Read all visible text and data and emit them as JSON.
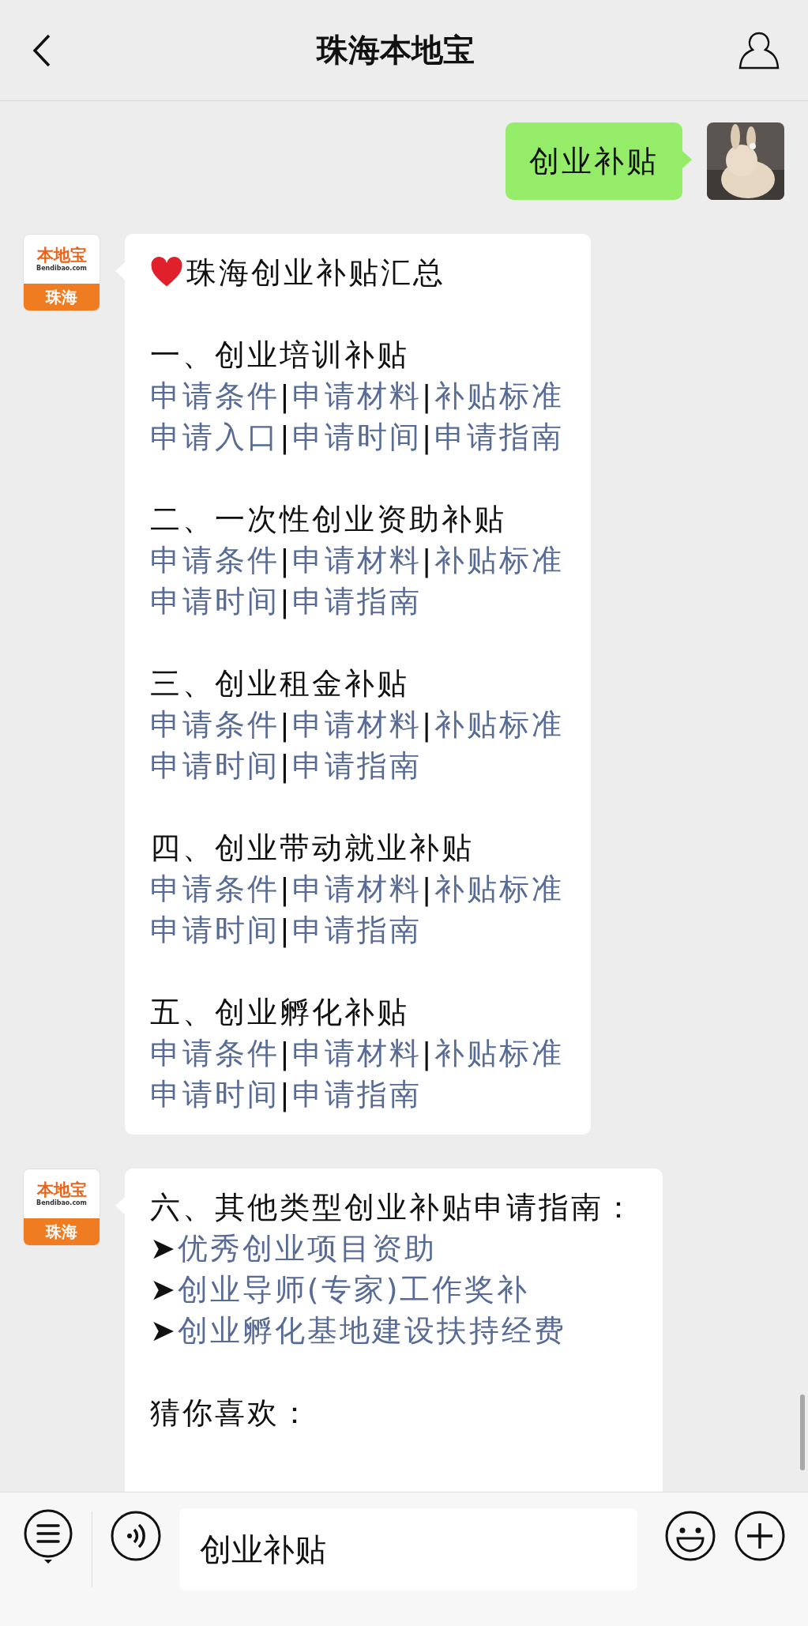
{
  "header": {
    "title": "珠海本地宝"
  },
  "messages": [
    {
      "kind": "user",
      "text": "创业补贴"
    },
    {
      "kind": "guide",
      "sender": {
        "logo": "本地宝",
        "domain": "Bendibao.com",
        "city": "珠海"
      },
      "title": "珠海创业补贴汇总",
      "separator": "|",
      "sections": [
        {
          "heading": "一、创业培训补贴",
          "rows": [
            [
              "申请条件",
              "申请材料",
              "补贴标准"
            ],
            [
              "申请入口",
              "申请时间",
              "申请指南"
            ]
          ]
        },
        {
          "heading": "二、一次性创业资助补贴",
          "rows": [
            [
              "申请条件",
              "申请材料",
              "补贴标准"
            ],
            [
              "申请时间",
              "申请指南"
            ]
          ]
        },
        {
          "heading": "三、创业租金补贴",
          "rows": [
            [
              "申请条件",
              "申请材料",
              "补贴标准"
            ],
            [
              "申请时间",
              "申请指南"
            ]
          ]
        },
        {
          "heading": "四、创业带动就业补贴",
          "rows": [
            [
              "申请条件",
              "申请材料",
              "补贴标准"
            ],
            [
              "申请时间",
              "申请指南"
            ]
          ]
        },
        {
          "heading": "五、创业孵化补贴",
          "rows": [
            [
              "申请条件",
              "申请材料",
              "补贴标准"
            ],
            [
              "申请时间",
              "申请指南"
            ]
          ]
        }
      ]
    },
    {
      "kind": "list",
      "sender": {
        "logo": "本地宝",
        "domain": "Bendibao.com",
        "city": "珠海"
      },
      "heading": "六、其他类型创业补贴申请指南：",
      "marker": "➤",
      "links": [
        "优秀创业项目资助",
        "创业导师(专家)工作奖补",
        "创业孵化基地建设扶持经费"
      ],
      "footer": "猜你喜欢："
    }
  ],
  "input": {
    "value": "创业补贴"
  }
}
